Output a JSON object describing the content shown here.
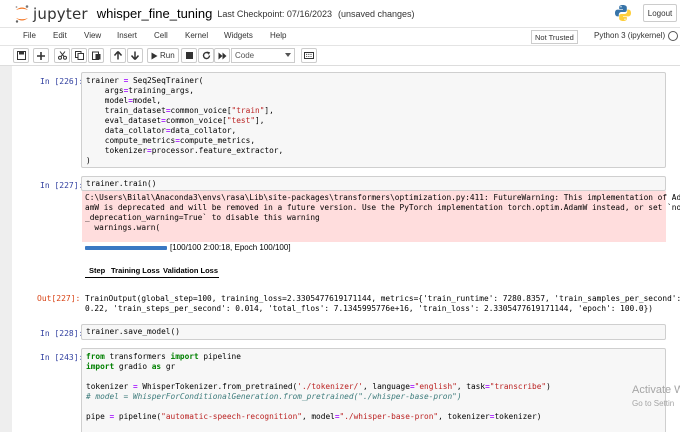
{
  "header": {
    "logo_text": "jupyter",
    "notebook_name": "whisper_fine_tuning",
    "checkpoint": "Last Checkpoint: 07/16/2023",
    "save_status": "(unsaved changes)",
    "logout_label": "Logout"
  },
  "menu": {
    "items": [
      "File",
      "Edit",
      "View",
      "Insert",
      "Cell",
      "Kernel",
      "Widgets",
      "Help"
    ],
    "trusted_label": "Not Trusted",
    "kernel_label": "Python 3 (ipykernel)"
  },
  "toolbar": {
    "run_label": "Run",
    "cell_type": "Code"
  },
  "cells": {
    "c226_prompt": "In [226]:",
    "c226_code": [
      "trainer = Seq2SeqTrainer(",
      "    args=training_args,",
      "    model=model,",
      "    train_dataset=common_voice[\"train\"],",
      "    eval_dataset=common_voice[\"test\"],",
      "    data_collator=data_collator,",
      "    compute_metrics=compute_metrics,",
      "    tokenizer=processor.feature_extractor,",
      ")"
    ],
    "c227_prompt": "In [227]:",
    "c227_code": "trainer.train()",
    "c227_stderr": [
      "C:\\Users\\Bilal\\Anaconda3\\envs\\rasa\\Lib\\site-packages\\transformers\\optimization.py:411: FutureWarning: This implementation of Ad",
      "amW is deprecated and will be removed in a future version. Use the PyTorch implementation torch.optim.AdamW instead, or set `no",
      "_deprecation_warning=True` to disable this warning",
      "  warnings.warn("
    ],
    "progress_fraction": 1.0,
    "progress_text": "[100/100 2:00:18, Epoch 100/100]",
    "table_headers": [
      "Step",
      "Training Loss",
      "Validation Loss"
    ],
    "out227_prompt": "Out[227]:",
    "out227_text": [
      "TrainOutput(global_step=100, training_loss=2.3305477619171144, metrics={'train_runtime': 7280.8357, 'train_samples_per_second':",
      "0.22, 'train_steps_per_second': 0.014, 'total_flos': 7.1345995776e+16, 'train_loss': 2.3305477619171144, 'epoch': 100.0})"
    ],
    "c228_prompt": "In [228]:",
    "c228_code": "trainer.save_model()",
    "c243_prompt": "In [243]:",
    "c243_code": [
      "from transformers import pipeline",
      "import gradio as gr",
      "",
      "tokenizer = WhisperTokenizer.from_pretrained('./tokenizer/', language=\"english\", task=\"transcribe\")",
      "# model = WhisperForConditionalGeneration.from_pretrained(\"./whisper-base-pron\")",
      "",
      "pipe = pipeline(\"automatic-speech-recognition\", model=\"./whisper-base-pron\", tokenizer=tokenizer)"
    ]
  },
  "watermark": {
    "line1": "Activate W",
    "line2": "Go to Settin"
  },
  "colors": {
    "accent": "#3a78c3",
    "stderr_bg": "#ffdddd",
    "prompt_in": "#303f9f",
    "prompt_out": "#d84315",
    "jupyter_orange": "#f37726"
  }
}
